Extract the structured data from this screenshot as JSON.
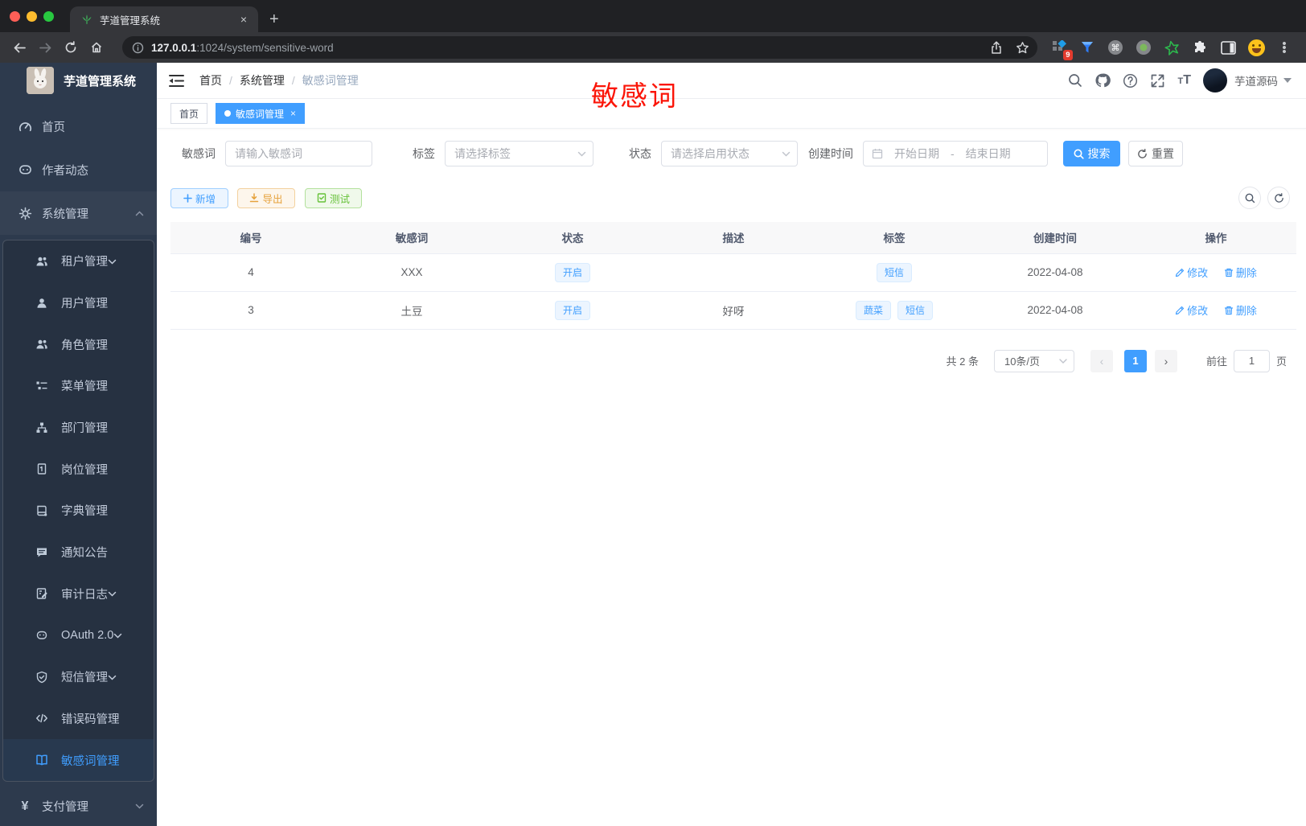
{
  "browser": {
    "tab_title": "芋道管理系统",
    "new_tab_label": "+",
    "close_tab_label": "×",
    "url_host": "127.0.0.1",
    "url_rest": ":1024/system/sensitive-word",
    "extension_badge": "9"
  },
  "sidebar": {
    "title": "芋道管理系统",
    "items": [
      {
        "label": "首页"
      },
      {
        "label": "作者动态"
      },
      {
        "label": "系统管理"
      },
      {
        "label": "租户管理"
      },
      {
        "label": "用户管理"
      },
      {
        "label": "角色管理"
      },
      {
        "label": "菜单管理"
      },
      {
        "label": "部门管理"
      },
      {
        "label": "岗位管理"
      },
      {
        "label": "字典管理"
      },
      {
        "label": "通知公告"
      },
      {
        "label": "审计日志"
      },
      {
        "label": "OAuth 2.0"
      },
      {
        "label": "短信管理"
      },
      {
        "label": "错误码管理"
      },
      {
        "label": "敏感词管理"
      },
      {
        "label": "支付管理"
      }
    ]
  },
  "header": {
    "breadcrumb": [
      {
        "label": "首页"
      },
      {
        "label": "系统管理"
      },
      {
        "label": "敏感词管理"
      }
    ],
    "separator": "/",
    "username": "芋道源码",
    "annotation": "敏感词"
  },
  "tabs": [
    {
      "label": "首页"
    },
    {
      "label": "敏感词管理",
      "close": "×"
    }
  ],
  "filter": {
    "keyword_label": "敏感词",
    "keyword_placeholder": "请输入敏感词",
    "tag_label": "标签",
    "tag_placeholder": "请选择标签",
    "status_label": "状态",
    "status_placeholder": "请选择启用状态",
    "date_label": "创建时间",
    "date_start_placeholder": "开始日期",
    "date_separator": "-",
    "date_end_placeholder": "结束日期",
    "search_label": "搜索",
    "reset_label": "重置"
  },
  "toolbar": {
    "add_label": "新增",
    "export_label": "导出",
    "test_label": "测试"
  },
  "table": {
    "columns": [
      "编号",
      "敏感词",
      "状态",
      "描述",
      "标签",
      "创建时间",
      "操作"
    ],
    "rows": [
      {
        "id": "4",
        "word": "XXX",
        "status": "开启",
        "description": "",
        "tags": [
          "短信"
        ],
        "created_at": "2022-04-08"
      },
      {
        "id": "3",
        "word": "土豆",
        "status": "开启",
        "description": "好呀",
        "tags": [
          "蔬菜",
          "短信"
        ],
        "created_at": "2022-04-08"
      }
    ],
    "edit_label": "修改",
    "delete_label": "删除"
  },
  "pagination": {
    "total_text": "共 2 条",
    "page_size": "10条/页",
    "prev_label": "‹",
    "next_label": "›",
    "current_page": "1",
    "goto_label": "前往",
    "goto_value": "1",
    "unit_label": "页"
  },
  "colors": {
    "accent": "#409eff",
    "annotation_red": "#fb1508",
    "warning": "#e6a23c",
    "success": "#67c23a",
    "sidebar_bg": "#2d3a4d"
  }
}
